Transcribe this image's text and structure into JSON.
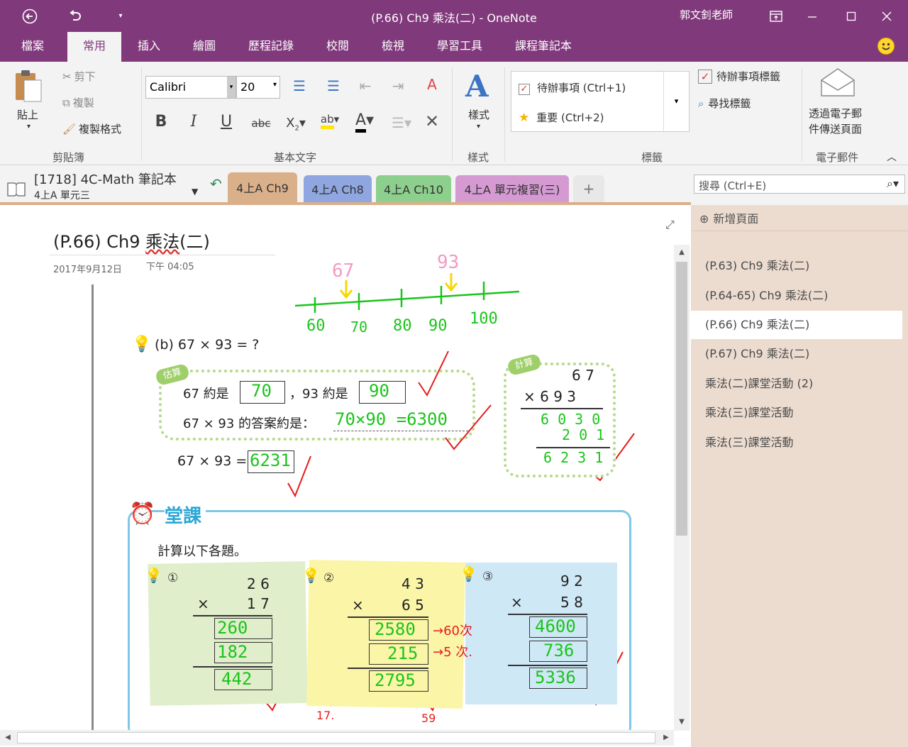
{
  "window": {
    "title": "(P.66) Ch9 乘法(二)  -  OneNote",
    "user": "郭文釗老師"
  },
  "ribbon_tabs": [
    "檔案",
    "常用",
    "插入",
    "繪圖",
    "歷程記錄",
    "校閱",
    "檢視",
    "學習工具",
    "課程筆記本"
  ],
  "ribbon": {
    "clipboard": {
      "paste": "貼上",
      "cut": "剪下",
      "copy": "複製",
      "format_painter": "複製格式",
      "label": "剪貼簿"
    },
    "basic_text": {
      "font": "Calibri",
      "size": "20",
      "label": "基本文字",
      "bold": "B",
      "italic": "I",
      "underline": "U",
      "strike": "abc"
    },
    "styles": {
      "label": "樣式",
      "button": "樣式"
    },
    "tags": {
      "todo": "待辦事項 (Ctrl+1)",
      "important": "重要 (Ctrl+2)",
      "todo_tag": "待辦事項標籤",
      "find_tags": "尋找標籤",
      "label": "標籤"
    },
    "email": {
      "button_line1": "透過電子郵",
      "button_line2": "件傳送頁面",
      "label": "電子郵件"
    }
  },
  "notebook": {
    "name": "[1718] 4C-Math 筆記本",
    "section": "4上A 單元三"
  },
  "sections": [
    {
      "label": "4上A Ch9",
      "color": "#dab08a"
    },
    {
      "label": "4上A Ch8",
      "color": "#8fa6e0"
    },
    {
      "label": "4上A Ch10",
      "color": "#8dcf8d"
    },
    {
      "label": "4上A 單元複習(三)",
      "color": "#d69ad3"
    },
    {
      "label": "+",
      "color": "#f3f3f3"
    }
  ],
  "search": {
    "placeholder": "搜尋 (Ctrl+E)"
  },
  "page": {
    "title_prefix": "(P.66) Ch9 ",
    "title_main": "乘法",
    "title_suffix": "(二)",
    "date": "2017年9月12日",
    "time": "下午 04:05"
  },
  "content": {
    "numberline_labels": [
      "60",
      "70",
      "80",
      "90",
      "100"
    ],
    "marks": [
      "67",
      "93"
    ],
    "question": "(b) 67 × 93 = ?",
    "estimate_tag": "估算",
    "line1a": "67 約是",
    "ans70": "70",
    "line1b": "，93 約是",
    "ans90": "90",
    "line2": "67 × 93 的答案約是：",
    "ans_est": "70×90 =6300",
    "line3": "67 × 93 =",
    "ans_exact": "6231",
    "calc_tag": "計算",
    "calc_top": "6 7",
    "calc_mul": "× 6 9 3",
    "calc_p1": "6 0 3 0",
    "calc_p2": "2 0 1",
    "calc_sum": "6 2 3 1",
    "lesson": "堂課",
    "lesson_instr": "計算以下各題。",
    "problems": [
      {
        "num": "①",
        "a": "2 6",
        "b": "1 7",
        "p1": "260",
        "p2": "182",
        "sum": "442"
      },
      {
        "num": "②",
        "a": "4 3",
        "b": "6 5",
        "p1": "2580",
        "p2": "215",
        "sum": "2795",
        "n1": "→60次",
        "n2": "→5 次."
      },
      {
        "num": "③",
        "a": "9 2",
        "b": "5 8",
        "p1": "4600",
        "p2": "736",
        "sum": "5336"
      }
    ],
    "bottom_notes": [
      "17.",
      "59"
    ]
  },
  "pages_pane": {
    "new_page": "新增頁面",
    "pages": [
      "(P.63) Ch9 乘法(二)",
      "(P.64-65) Ch9 乘法(二)",
      "(P.66) Ch9 乘法(二)",
      "(P.67) Ch9 乘法(二)",
      "乘法(二)課堂活動 (2)",
      "乘法(三)課堂活動",
      "乘法(三)課堂活動"
    ],
    "selected_index": 2
  }
}
